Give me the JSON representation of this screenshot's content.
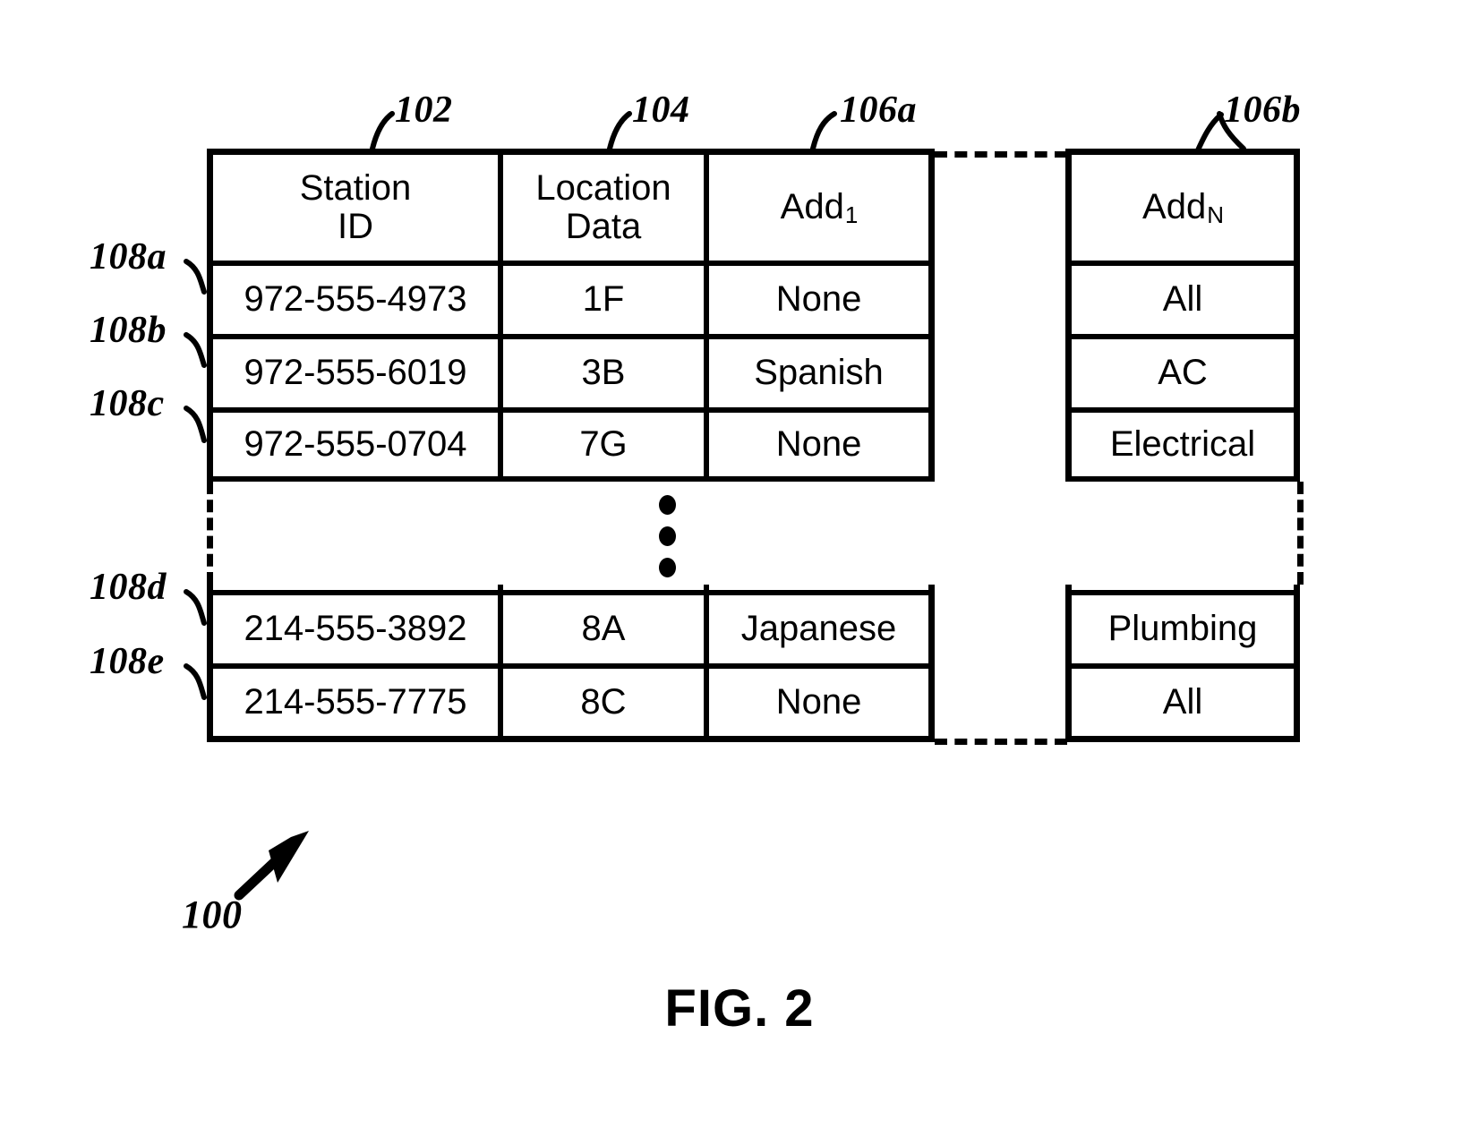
{
  "figure": {
    "caption": "FIG. 2",
    "overall_ref": "100"
  },
  "column_refs": {
    "station_id": "102",
    "location_data": "104",
    "add_first": "106a",
    "add_last": "106b"
  },
  "row_refs": {
    "r1": "108a",
    "r2": "108b",
    "r3": "108c",
    "r4": "108d",
    "r5": "108e"
  },
  "table": {
    "headers": {
      "station_id_line1": "Station",
      "station_id_line2": "ID",
      "location_data_line1": "Location",
      "location_data_line2": "Data",
      "add_first_base": "Add",
      "add_first_sub": "1",
      "add_last_base": "Add",
      "add_last_sub": "N"
    },
    "rows": [
      {
        "ref": "108a",
        "station_id": "972-555-4973",
        "location_data": "1F",
        "add_first": "None",
        "add_last": "All"
      },
      {
        "ref": "108b",
        "station_id": "972-555-6019",
        "location_data": "3B",
        "add_first": "Spanish",
        "add_last": "AC"
      },
      {
        "ref": "108c",
        "station_id": "972-555-0704",
        "location_data": "7G",
        "add_first": "None",
        "add_last": "Electrical"
      },
      {
        "ref": "108d",
        "station_id": "214-555-3892",
        "location_data": "8A",
        "add_first": "Japanese",
        "add_last": "Plumbing"
      },
      {
        "ref": "108e",
        "station_id": "214-555-7775",
        "location_data": "8C",
        "add_first": "None",
        "add_last": "All"
      }
    ],
    "continuation_indicator": "vertical-ellipsis"
  },
  "colors": {
    "ink": "#000000",
    "paper": "#ffffff"
  }
}
